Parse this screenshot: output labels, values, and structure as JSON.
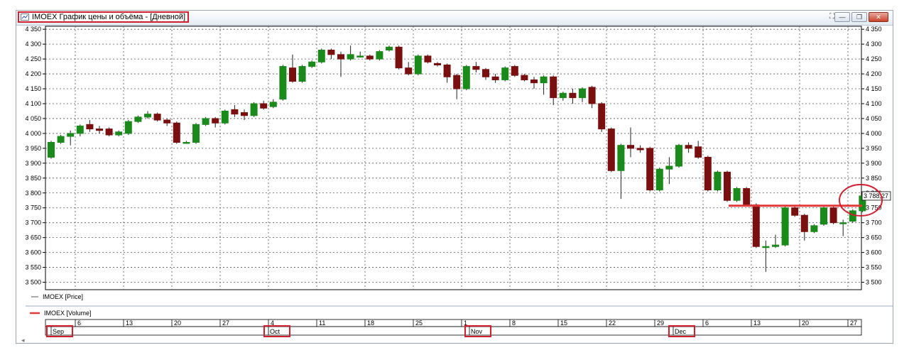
{
  "window": {
    "title": "IMOEX График цены и объёма - [Дневной]",
    "sys_icon": "grid-icon"
  },
  "legend": {
    "price_label": "IMOEX [Price]",
    "volume_label": "IMOEX [Volume]"
  },
  "last_price_label": "3 788,27",
  "colors": {
    "up": "#1a8a1a",
    "down": "#7a0f0f",
    "level_line": "#e23a3a",
    "annotation": "#d21f2f"
  },
  "chart_data": {
    "type": "candlestick",
    "y_ticks": [
      "3 500",
      "3 550",
      "3 600",
      "3 650",
      "3 700",
      "3 750",
      "3 800",
      "3 850",
      "3 900",
      "3 950",
      "4 000",
      "4 050",
      "4 100",
      "4 150",
      "4 200",
      "4 250",
      "4 300",
      "4 350"
    ],
    "ylim": [
      3475,
      4360
    ],
    "grid": true,
    "x_day_labels": [
      "6",
      "13",
      "20",
      "27",
      "4",
      "11",
      "18",
      "25",
      "1",
      "8",
      "15",
      "22",
      "29",
      "6",
      "13",
      "20",
      "27"
    ],
    "month_labels": [
      "Sep",
      "Oct",
      "Nov",
      "Dec"
    ],
    "horizontal_level": 3757,
    "candles": [
      {
        "o": 3920,
        "c": 3970,
        "h": 3975,
        "l": 3915
      },
      {
        "o": 3970,
        "c": 3990,
        "h": 3995,
        "l": 3965
      },
      {
        "o": 3990,
        "c": 4000,
        "h": 4010,
        "l": 3960
      },
      {
        "o": 4000,
        "c": 4025,
        "h": 4030,
        "l": 3990
      },
      {
        "o": 4030,
        "c": 4015,
        "h": 4045,
        "l": 4005
      },
      {
        "o": 4015,
        "c": 4010,
        "h": 4025,
        "l": 4000
      },
      {
        "o": 4015,
        "c": 3995,
        "h": 4020,
        "l": 3990
      },
      {
        "o": 3995,
        "c": 4005,
        "h": 4010,
        "l": 3990
      },
      {
        "o": 4000,
        "c": 4040,
        "h": 4045,
        "l": 3995
      },
      {
        "o": 4040,
        "c": 4055,
        "h": 4060,
        "l": 4035
      },
      {
        "o": 4055,
        "c": 4065,
        "h": 4075,
        "l": 4050
      },
      {
        "o": 4065,
        "c": 4045,
        "h": 4070,
        "l": 4040
      },
      {
        "o": 4045,
        "c": 4035,
        "h": 4050,
        "l": 4025
      },
      {
        "o": 4035,
        "c": 3970,
        "h": 4040,
        "l": 3965
      },
      {
        "o": 3970,
        "c": 3970,
        "h": 3975,
        "l": 3965
      },
      {
        "o": 3970,
        "c": 4030,
        "h": 4035,
        "l": 3965
      },
      {
        "o": 4030,
        "c": 4050,
        "h": 4055,
        "l": 4025
      },
      {
        "o": 4050,
        "c": 4035,
        "h": 4055,
        "l": 4020
      },
      {
        "o": 4035,
        "c": 4075,
        "h": 4080,
        "l": 4030
      },
      {
        "o": 4080,
        "c": 4065,
        "h": 4095,
        "l": 4055
      },
      {
        "o": 4070,
        "c": 4060,
        "h": 4080,
        "l": 4045
      },
      {
        "o": 4060,
        "c": 4100,
        "h": 4105,
        "l": 4055
      },
      {
        "o": 4100,
        "c": 4085,
        "h": 4110,
        "l": 4080
      },
      {
        "o": 4090,
        "c": 4105,
        "h": 4115,
        "l": 4085
      },
      {
        "o": 4115,
        "c": 4225,
        "h": 4230,
        "l": 4110
      },
      {
        "o": 4220,
        "c": 4175,
        "h": 4265,
        "l": 4170
      },
      {
        "o": 4175,
        "c": 4225,
        "h": 4230,
        "l": 4170
      },
      {
        "o": 4225,
        "c": 4240,
        "h": 4245,
        "l": 4220
      },
      {
        "o": 4240,
        "c": 4280,
        "h": 4285,
        "l": 4235
      },
      {
        "o": 4280,
        "c": 4265,
        "h": 4285,
        "l": 4250
      },
      {
        "o": 4265,
        "c": 4250,
        "h": 4275,
        "l": 4190
      },
      {
        "o": 4250,
        "c": 4265,
        "h": 4295,
        "l": 4245
      },
      {
        "o": 4260,
        "c": 4260,
        "h": 4275,
        "l": 4255
      },
      {
        "o": 4260,
        "c": 4250,
        "h": 4265,
        "l": 4245
      },
      {
        "o": 4250,
        "c": 4275,
        "h": 4280,
        "l": 4245
      },
      {
        "o": 4280,
        "c": 4290,
        "h": 4295,
        "l": 4275
      },
      {
        "o": 4290,
        "c": 4220,
        "h": 4295,
        "l": 4215
      },
      {
        "o": 4220,
        "c": 4200,
        "h": 4240,
        "l": 4195
      },
      {
        "o": 4200,
        "c": 4260,
        "h": 4265,
        "l": 4195
      },
      {
        "o": 4260,
        "c": 4240,
        "h": 4265,
        "l": 4235
      },
      {
        "o": 4235,
        "c": 4230,
        "h": 4240,
        "l": 4225
      },
      {
        "o": 4230,
        "c": 4190,
        "h": 4235,
        "l": 4170
      },
      {
        "o": 4195,
        "c": 4150,
        "h": 4200,
        "l": 4115
      },
      {
        "o": 4150,
        "c": 4225,
        "h": 4230,
        "l": 4145
      },
      {
        "o": 4225,
        "c": 4215,
        "h": 4240,
        "l": 4205
      },
      {
        "o": 4215,
        "c": 4190,
        "h": 4220,
        "l": 4180
      },
      {
        "o": 4190,
        "c": 4180,
        "h": 4200,
        "l": 4170
      },
      {
        "o": 4180,
        "c": 4220,
        "h": 4225,
        "l": 4175
      },
      {
        "o": 4225,
        "c": 4195,
        "h": 4230,
        "l": 4190
      },
      {
        "o": 4195,
        "c": 4180,
        "h": 4200,
        "l": 4175
      },
      {
        "o": 4180,
        "c": 4170,
        "h": 4190,
        "l": 4150
      },
      {
        "o": 4170,
        "c": 4190,
        "h": 4195,
        "l": 4130
      },
      {
        "o": 4190,
        "c": 4120,
        "h": 4195,
        "l": 4095
      },
      {
        "o": 4120,
        "c": 4135,
        "h": 4140,
        "l": 4110
      },
      {
        "o": 4135,
        "c": 4120,
        "h": 4150,
        "l": 4100
      },
      {
        "o": 4120,
        "c": 4150,
        "h": 4155,
        "l": 4105
      },
      {
        "o": 4155,
        "c": 4100,
        "h": 4160,
        "l": 4085
      },
      {
        "o": 4100,
        "c": 4015,
        "h": 4105,
        "l": 4005
      },
      {
        "o": 4015,
        "c": 3875,
        "h": 4020,
        "l": 3870
      },
      {
        "o": 3875,
        "c": 3960,
        "h": 3965,
        "l": 3780
      },
      {
        "o": 3960,
        "c": 3950,
        "h": 4020,
        "l": 3920
      },
      {
        "o": 3950,
        "c": 3945,
        "h": 3960,
        "l": 3935
      },
      {
        "o": 3950,
        "c": 3810,
        "h": 3955,
        "l": 3805
      },
      {
        "o": 3810,
        "c": 3880,
        "h": 3885,
        "l": 3805
      },
      {
        "o": 3880,
        "c": 3890,
        "h": 3920,
        "l": 3830
      },
      {
        "o": 3890,
        "c": 3960,
        "h": 3965,
        "l": 3885
      },
      {
        "o": 3960,
        "c": 3950,
        "h": 3970,
        "l": 3935
      },
      {
        "o": 3955,
        "c": 3920,
        "h": 3975,
        "l": 3915
      },
      {
        "o": 3920,
        "c": 3810,
        "h": 3925,
        "l": 3805
      },
      {
        "o": 3810,
        "c": 3870,
        "h": 3875,
        "l": 3805
      },
      {
        "o": 3870,
        "c": 3775,
        "h": 3875,
        "l": 3770
      },
      {
        "o": 3775,
        "c": 3815,
        "h": 3820,
        "l": 3770
      },
      {
        "o": 3815,
        "c": 3760,
        "h": 3820,
        "l": 3755
      },
      {
        "o": 3760,
        "c": 3620,
        "h": 3765,
        "l": 3615
      },
      {
        "o": 3620,
        "c": 3620,
        "h": 3640,
        "l": 3535
      },
      {
        "o": 3620,
        "c": 3625,
        "h": 3660,
        "l": 3615
      },
      {
        "o": 3625,
        "c": 3750,
        "h": 3755,
        "l": 3620
      },
      {
        "o": 3750,
        "c": 3725,
        "h": 3760,
        "l": 3720
      },
      {
        "o": 3725,
        "c": 3670,
        "h": 3730,
        "l": 3640
      },
      {
        "o": 3670,
        "c": 3690,
        "h": 3695,
        "l": 3665
      },
      {
        "o": 3695,
        "c": 3750,
        "h": 3755,
        "l": 3690
      },
      {
        "o": 3750,
        "c": 3700,
        "h": 3755,
        "l": 3695
      },
      {
        "o": 3700,
        "c": 3700,
        "h": 3710,
        "l": 3655
      },
      {
        "o": 3705,
        "c": 3740,
        "h": 3745,
        "l": 3700
      },
      {
        "o": 3740,
        "c": 3790,
        "h": 3795,
        "l": 3735
      }
    ]
  }
}
